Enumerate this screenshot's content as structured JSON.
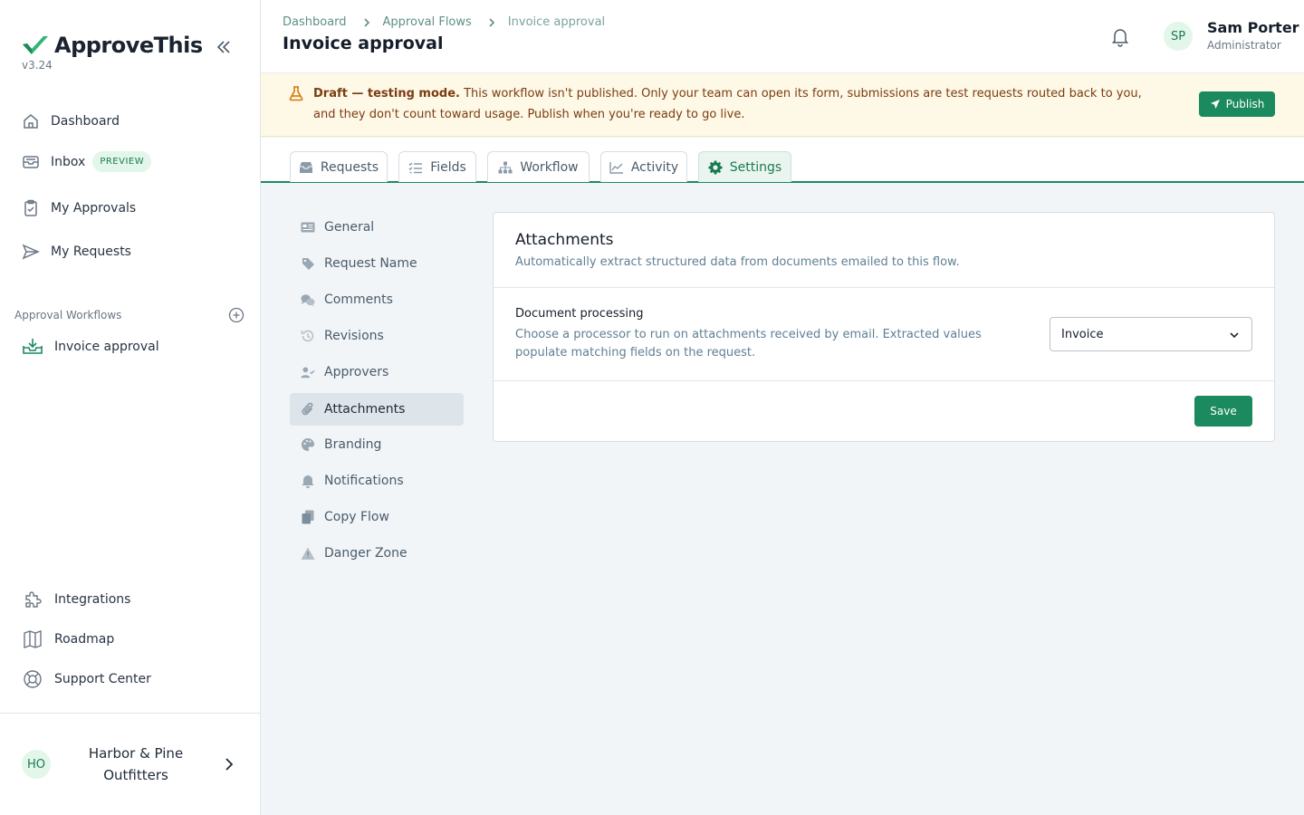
{
  "app": {
    "name": "ApproveThis",
    "version": "v3.24"
  },
  "sidebar": {
    "items": [
      {
        "label": "Dashboard",
        "icon": "home-icon"
      },
      {
        "label": "Inbox",
        "icon": "inbox-icon",
        "badge": "PREVIEW"
      },
      {
        "label": "My Approvals",
        "icon": "clipboard-check-icon"
      },
      {
        "label": "My Requests",
        "icon": "send-icon"
      }
    ],
    "section_label": "Approval Workflows",
    "flows": [
      {
        "label": "Invoice approval",
        "icon": "inbox-download-icon"
      }
    ],
    "bottom_items": [
      {
        "label": "Integrations",
        "icon": "puzzle-icon"
      },
      {
        "label": "Roadmap",
        "icon": "map-icon"
      },
      {
        "label": "Support Center",
        "icon": "lifebuoy-icon"
      }
    ],
    "org": {
      "initials": "HO",
      "name": "Harbor & Pine Outfitters"
    }
  },
  "header": {
    "breadcrumb": [
      "Dashboard",
      "Approval Flows",
      "Invoice approval"
    ],
    "title": "Invoice approval",
    "user": {
      "initials": "SP",
      "name": "Sam Porter",
      "role": "Administrator"
    }
  },
  "banner": {
    "strong": "Draft — testing mode.",
    "message": " This workflow isn't published. Only your team can open its form, submissions are test requests routed back to you, and they don't count toward usage. Publish when you're ready to go live.",
    "button": "Publish"
  },
  "tabs": [
    {
      "label": "Requests",
      "icon": "inbox-tray-icon",
      "active": false
    },
    {
      "label": "Fields",
      "icon": "list-check-icon",
      "active": false
    },
    {
      "label": "Workflow",
      "icon": "sitemap-icon",
      "active": false
    },
    {
      "label": "Activity",
      "icon": "chart-line-icon",
      "active": false
    },
    {
      "label": "Settings",
      "icon": "gear-icon",
      "active": true
    }
  ],
  "settings_menu": [
    {
      "label": "General",
      "icon": "id-card-icon"
    },
    {
      "label": "Request Name",
      "icon": "tag-icon"
    },
    {
      "label": "Comments",
      "icon": "comments-icon"
    },
    {
      "label": "Revisions",
      "icon": "history-icon"
    },
    {
      "label": "Approvers",
      "icon": "user-check-icon"
    },
    {
      "label": "Attachments",
      "icon": "paperclip-icon",
      "active": true
    },
    {
      "label": "Branding",
      "icon": "palette-icon"
    },
    {
      "label": "Notifications",
      "icon": "bell-icon"
    },
    {
      "label": "Copy Flow",
      "icon": "copy-icon"
    },
    {
      "label": "Danger Zone",
      "icon": "warning-icon"
    }
  ],
  "card": {
    "title": "Attachments",
    "subtitle": "Automatically extract structured data from documents emailed to this flow.",
    "field_label": "Document processing",
    "field_help": "Choose a processor to run on attachments received by email. Extracted values populate matching fields on the request.",
    "select_value": "Invoice",
    "save_label": "Save"
  },
  "colors": {
    "brand": "#1b8a5f",
    "banner_bg": "#fef8e6",
    "banner_text": "#7a3d12",
    "sidebar_active_bg": "#dde4ea"
  }
}
